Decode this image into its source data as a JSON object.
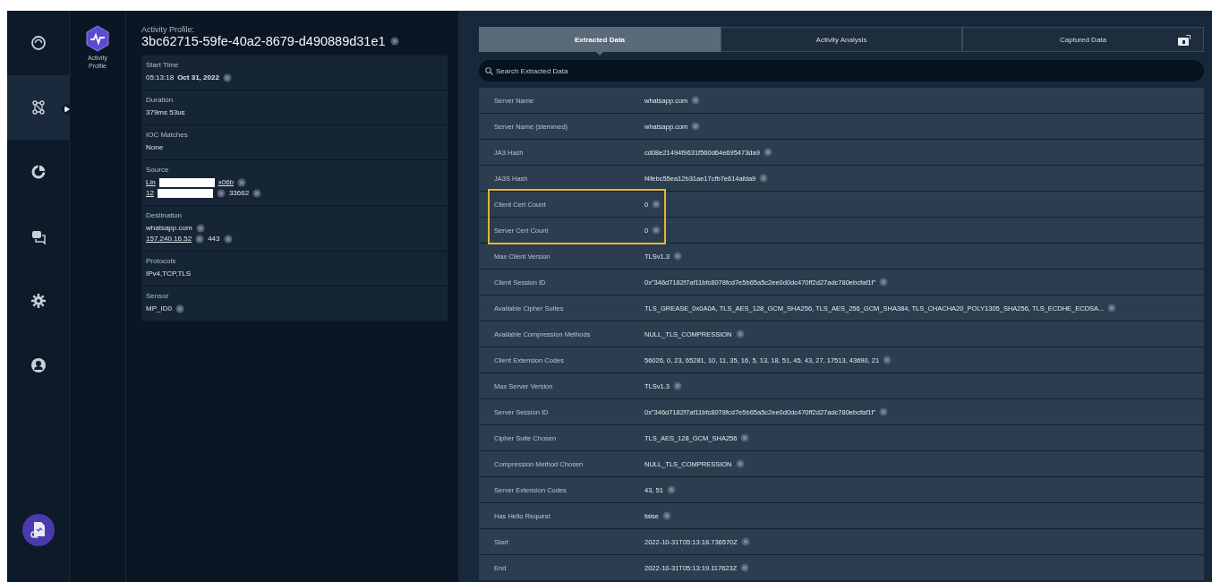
{
  "nav_rail": {
    "items": [
      {
        "selected": false
      },
      {
        "selected": true
      },
      {
        "selected": false
      },
      {
        "selected": false
      },
      {
        "selected": false
      },
      {
        "selected": false
      }
    ]
  },
  "profile_badge": {
    "label": "Activity Profile"
  },
  "detail": {
    "heading_label": "Activity Profile:",
    "heading_id": "3bc62715-59fe-40a2-8679-d490889d31e1",
    "fields": [
      {
        "label": "Start Time",
        "kind": "time",
        "values": [
          {
            "time": "05:13:18",
            "date": "Oct 31, 2022"
          }
        ]
      },
      {
        "label": "Duration",
        "kind": "plain",
        "values": [
          {
            "text": "379ms 53us"
          }
        ]
      },
      {
        "label": "IOC Matches",
        "kind": "plain",
        "values": [
          {
            "text": "None"
          }
        ]
      },
      {
        "label": "Source",
        "kind": "redacted",
        "values": [
          {
            "before": "Lin",
            "after": "x06b"
          },
          {
            "before": "12",
            "port": "33662"
          }
        ]
      },
      {
        "label": "Destination",
        "kind": "endpoint",
        "values": [
          {
            "host": "whatsapp.com"
          },
          {
            "ip": "157.240.16.52",
            "port": "443"
          }
        ]
      },
      {
        "label": "Protocols",
        "kind": "plain",
        "values": [
          {
            "text": "IPv4,TCP,TLS"
          }
        ]
      },
      {
        "label": "Sensor",
        "kind": "copyable",
        "values": [
          {
            "text": "MP_ID0"
          }
        ]
      }
    ]
  },
  "tabs": [
    {
      "label": "Extracted Data",
      "selected": true,
      "kind": "text"
    },
    {
      "label": "Activity Analysis",
      "selected": false,
      "kind": "text"
    },
    {
      "label": "Captured Data",
      "selected": false,
      "kind": "export"
    }
  ],
  "search": {
    "placeholder": "Search Extracted Data"
  },
  "rows": [
    {
      "name": "Server Name",
      "value": "whatsapp.com",
      "highlighted": false
    },
    {
      "name": "Server Name (stemmed)",
      "value": "whatsapp.com",
      "highlighted": false
    },
    {
      "name": "JA3 Hash",
      "value": "cd08e21494f9631f560d64e695473da9",
      "highlighted": false
    },
    {
      "name": "JA3S Hash",
      "value": "f4febc55ea12b31ae17cfb7e614afda9",
      "highlighted": false
    },
    {
      "name": "Client Cert Count",
      "value": "0",
      "highlighted": true
    },
    {
      "name": "Server Cert Count",
      "value": "0",
      "highlighted": true
    },
    {
      "name": "Max Client Version",
      "value": "TLSv1.3",
      "highlighted": false
    },
    {
      "name": "Client Session ID",
      "value": "0x\"346d7182f7af11bfc8078fcd7e5b65a5c2ee0d0dc470ff2d27adc780ebcfaf1f\"",
      "highlighted": false
    },
    {
      "name": "Available Cipher Suites",
      "value": "TLS_GREASE_0x0A0A, TLS_AES_128_GCM_SHA256, TLS_AES_256_GCM_SHA384, TLS_CHACHA20_POLY1305_SHA256, TLS_ECDHE_ECDSA...",
      "highlighted": false
    },
    {
      "name": "Available Compression Methods",
      "value": "NULL_TLS_COMPRESSION",
      "highlighted": false
    },
    {
      "name": "Client Extension Codes",
      "value": "56026, 0, 23, 65281, 10, 11, 35, 16, 5, 13, 18, 51, 45, 43, 27, 17513, 43690, 21",
      "highlighted": false
    },
    {
      "name": "Max Server Version",
      "value": "TLSv1.3",
      "highlighted": false
    },
    {
      "name": "Server Session ID",
      "value": "0x\"346d7182f7af11bfc8078fcd7e5b65a5c2ee0d0dc470ff2d27adc780ebcfaf1f\"",
      "highlighted": false
    },
    {
      "name": "Cipher Suite Chosen",
      "value": "TLS_AES_128_GCM_SHA256",
      "highlighted": false
    },
    {
      "name": "Compression Method Chosen",
      "value": "NULL_TLS_COMPRESSION",
      "highlighted": false
    },
    {
      "name": "Server Extension Codes",
      "value": "43, 51",
      "highlighted": false
    },
    {
      "name": "Has Hello Request",
      "value": "false",
      "highlighted": false
    },
    {
      "name": "Start",
      "value": "2022-10-31T05:13:18.736570Z",
      "highlighted": false
    },
    {
      "name": "End",
      "value": "2022-10-31T05:13:19.117623Z",
      "highlighted": false
    }
  ]
}
